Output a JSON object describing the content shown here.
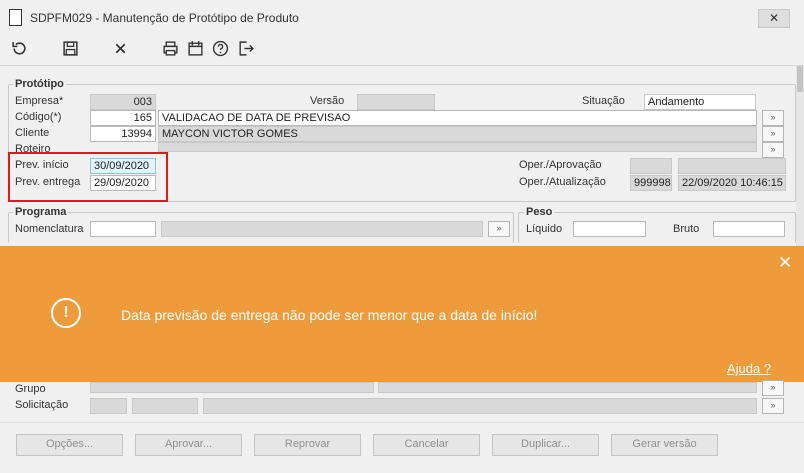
{
  "window": {
    "title": "SDPFM029 - Manutenção de Protótipo de Produto",
    "close_glyph": "✕"
  },
  "toolbar": {
    "icons": [
      "refresh-icon",
      "save-icon",
      "close-icon",
      "print-icon",
      "calendar-icon",
      "help-icon",
      "exit-icon"
    ]
  },
  "prototipo": {
    "legend": "Protótipo",
    "empresa_label": "Empresa*",
    "empresa_value": "003",
    "versao_label": "Versão",
    "versao_value": "",
    "situacao_label": "Situação",
    "situacao_value": "Andamento",
    "codigo_label": "Código(*)",
    "codigo_value": "165",
    "codigo_desc": "VALIDACAO DE DATA DE PREVISAO",
    "cliente_label": "Cliente",
    "cliente_value": "13994",
    "cliente_desc": "MAYCON VICTOR GOMES",
    "roteiro_label": "Roteiro",
    "prev_inicio_label": "Prev. início",
    "prev_inicio_value": "30/09/2020",
    "prev_entrega_label": "Prev. entrega",
    "prev_entrega_value": "29/09/2020",
    "oper_aprov_label": "Oper./Aprovação",
    "oper_atual_label": "Oper./Atualização",
    "oper_atual_code": "999998",
    "oper_atual_date": "22/09/2020 10:46:15"
  },
  "programa": {
    "legend": "Programa",
    "nomenclatura_label": "Nomenclatura"
  },
  "peso": {
    "legend": "Peso",
    "liquido_label": "Líquido",
    "bruto_label": "Bruto"
  },
  "lower": {
    "grupo_label": "Grupo",
    "solicitacao_label": "Solicitação"
  },
  "lookup_glyph": "»",
  "toast": {
    "message": "Data previsão de entrega não pode ser menor que a data de início!",
    "help_link": "Ajuda ?",
    "close_glyph": "✕",
    "icon_glyph": "!",
    "color": "#ee9b3b"
  },
  "buttons": [
    {
      "label": "Opções..."
    },
    {
      "label": "Aprovar..."
    },
    {
      "label": "Reprovar"
    },
    {
      "label": "Cancelar"
    },
    {
      "label": "Duplicar..."
    },
    {
      "label": "Gerar versão"
    }
  ]
}
